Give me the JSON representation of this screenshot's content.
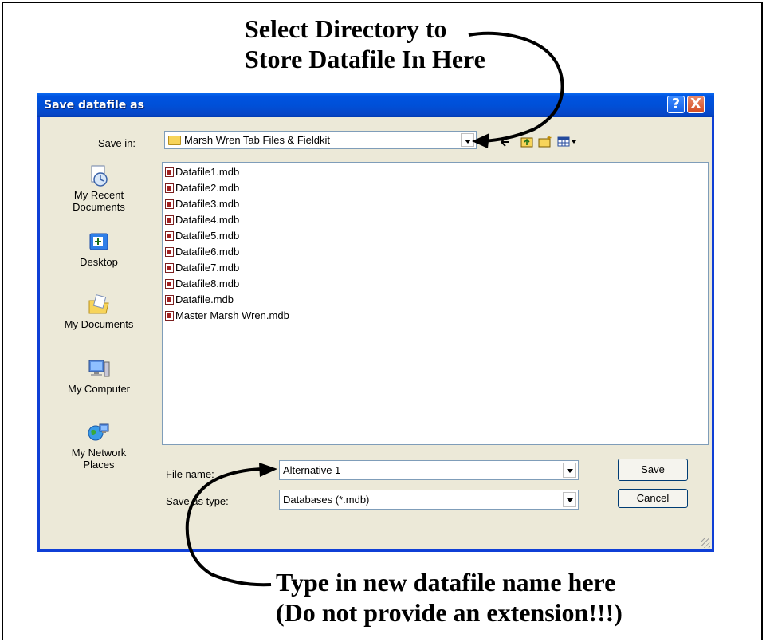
{
  "annotations": {
    "top_line1": "Select Directory to",
    "top_line2": "Store Datafile In Here",
    "bottom_line1": "Type in new datafile name here",
    "bottom_line2": "(Do not provide an extension!!!)"
  },
  "dialog": {
    "title": "Save datafile as",
    "help_icon": "?",
    "close_icon": "X",
    "save_in_label": "Save in:",
    "save_in_value": "Marsh Wren Tab Files & Fieldkit",
    "places": [
      {
        "label_line1": "My Recent",
        "label_line2": "Documents",
        "icon": "recent-documents-icon"
      },
      {
        "label_line1": "Desktop",
        "label_line2": "",
        "icon": "desktop-icon"
      },
      {
        "label_line1": "My Documents",
        "label_line2": "",
        "icon": "my-documents-icon"
      },
      {
        "label_line1": "My Computer",
        "label_line2": "",
        "icon": "my-computer-icon"
      },
      {
        "label_line1": "My Network",
        "label_line2": "Places",
        "icon": "network-places-icon"
      }
    ],
    "files": [
      "Datafile1.mdb",
      "Datafile2.mdb",
      "Datafile3.mdb",
      "Datafile4.mdb",
      "Datafile5.mdb",
      "Datafile6.mdb",
      "Datafile7.mdb",
      "Datafile8.mdb",
      "Datafile.mdb",
      "Master Marsh Wren.mdb"
    ],
    "file_name_label": "File name:",
    "file_name_value": "Alternative 1",
    "save_as_type_label": "Save as type:",
    "save_as_type_value": "Databases (*.mdb)",
    "save_button": "Save",
    "cancel_button": "Cancel"
  },
  "colors": {
    "titlebar": "#0050d8",
    "dialog_bg": "#ece9d8",
    "close_button": "#d44b21"
  }
}
